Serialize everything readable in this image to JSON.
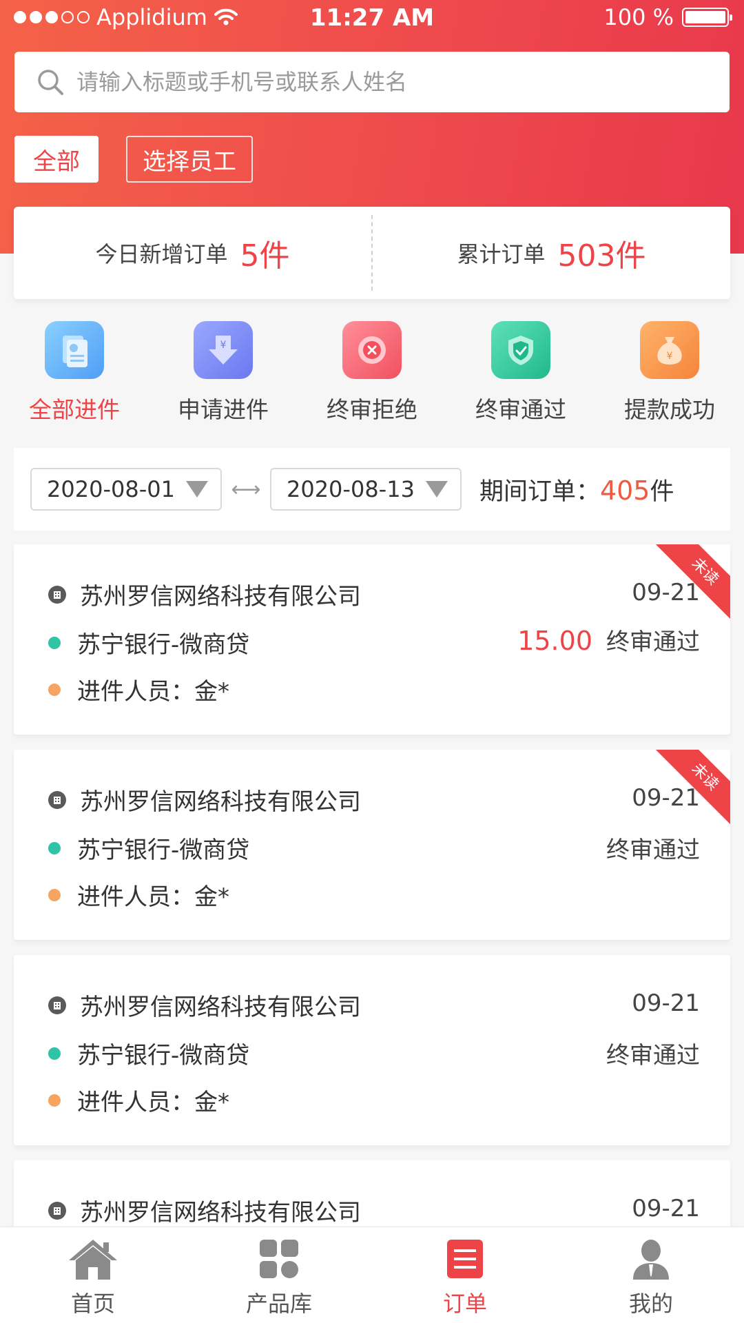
{
  "status_bar": {
    "carrier": "Applidium",
    "time": "11:27 AM",
    "battery": "100 %",
    "icons": [
      "signal-dots-icon",
      "wifi-icon",
      "battery-icon"
    ]
  },
  "search": {
    "placeholder": "请输入标题或手机号或联系人姓名",
    "value": ""
  },
  "filters": {
    "all_label": "全部",
    "employee_label": "选择员工"
  },
  "stats": {
    "today_label": "今日新增订单",
    "today_value": "5件",
    "total_label": "累计订单",
    "total_value": "503件"
  },
  "categories": [
    {
      "label": "全部进件",
      "icon": "document-icon",
      "active": true
    },
    {
      "label": "申请进件",
      "icon": "yen-download-icon",
      "active": false
    },
    {
      "label": "终审拒绝",
      "icon": "reject-icon",
      "active": false
    },
    {
      "label": "终审通过",
      "icon": "shield-check-icon",
      "active": false
    },
    {
      "label": "提款成功",
      "icon": "money-bag-icon",
      "active": false
    }
  ],
  "date_filter": {
    "start": "2020-08-01",
    "end": "2020-08-13",
    "period_label": "期间订单：",
    "period_count": "405",
    "period_unit": "件"
  },
  "orders": [
    {
      "company": "苏州罗信网络科技有限公司",
      "date": "09-21",
      "product": "苏宁银行-微商贷",
      "amount": "15.00",
      "status": "终审通过",
      "agent": "进件人员：金*",
      "badge": "未读"
    },
    {
      "company": "苏州罗信网络科技有限公司",
      "date": "09-21",
      "product": "苏宁银行-微商贷",
      "amount": "",
      "status": "终审通过",
      "agent": "进件人员：金*",
      "badge": "未读"
    },
    {
      "company": "苏州罗信网络科技有限公司",
      "date": "09-21",
      "product": "苏宁银行-微商贷",
      "amount": "",
      "status": "终审通过",
      "agent": "进件人员：金*",
      "badge": ""
    },
    {
      "company": "苏州罗信网络科技有限公司",
      "date": "09-21",
      "product": "",
      "amount": "",
      "status": "",
      "agent": "",
      "badge": ""
    }
  ],
  "tabbar": [
    {
      "label": "首页",
      "icon": "home-icon",
      "active": false
    },
    {
      "label": "产品库",
      "icon": "grid-icon",
      "active": false
    },
    {
      "label": "订单",
      "icon": "order-list-icon",
      "active": true
    },
    {
      "label": "我的",
      "icon": "user-icon",
      "active": false
    }
  ],
  "colors": {
    "accent": "#ee4347",
    "header_gradient_start": "#f46248",
    "header_gradient_end": "#e8384c",
    "product_dot": "#2ec4a5",
    "agent_dot": "#f5a462"
  }
}
